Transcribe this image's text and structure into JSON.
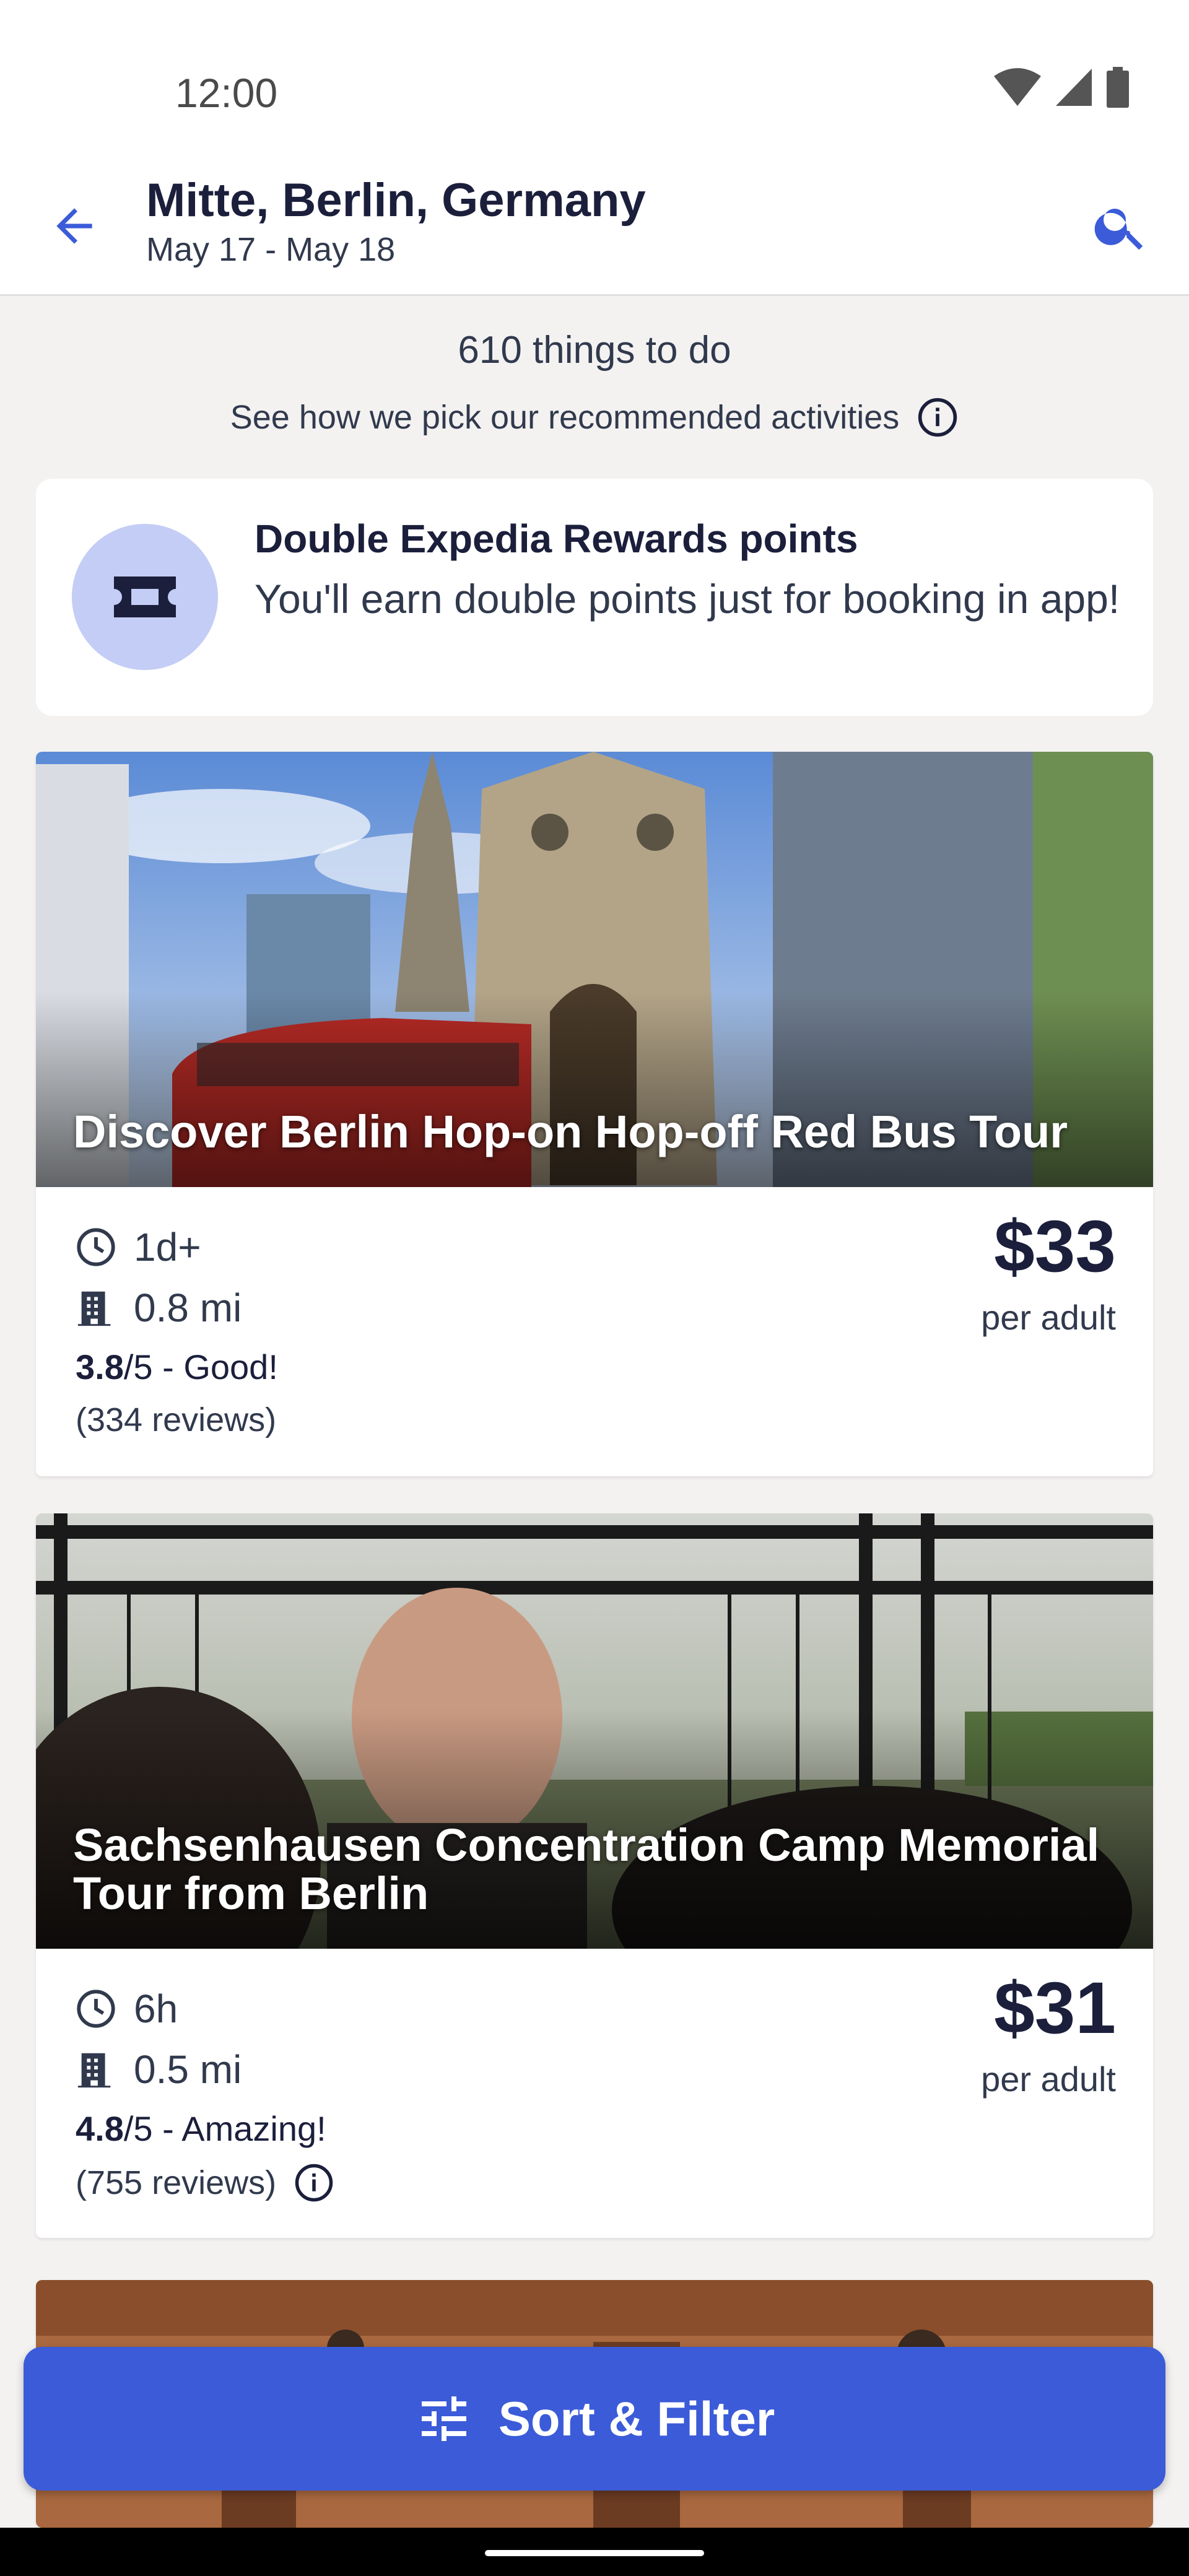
{
  "status_bar": {
    "time": "12:00",
    "icons": [
      "wifi-icon",
      "signal-icon",
      "battery-icon"
    ]
  },
  "header": {
    "title": "Mitte, Berlin, Germany",
    "dates": "May 17 - May 18",
    "back_icon": "arrow-left-icon",
    "search_icon": "search-icon"
  },
  "summary": {
    "count": "610 things to do",
    "recommend_text": "See how we pick our recommended activities",
    "info_icon": "info-icon"
  },
  "rewards": {
    "icon": "ticket-icon",
    "title": "Double Expedia Rewards points",
    "text": "You'll earn double points just for booking in app!"
  },
  "activities": [
    {
      "title": "Discover Berlin Hop-on Hop-off Red Bus Tour",
      "duration": "1d+",
      "distance": "0.8 mi",
      "rating": "3.8",
      "rating_suffix": "/5 - Good!",
      "reviews": "(334 reviews)",
      "price": "$33",
      "price_unit": "per adult"
    },
    {
      "title": "Sachsenhausen Concentration Camp Memorial Tour from Berlin",
      "duration": "6h",
      "distance": "0.5 mi",
      "rating": "4.8",
      "rating_suffix": "/5 - Amazing!",
      "reviews": "(755 reviews)",
      "price": "$31",
      "price_unit": "per adult"
    }
  ],
  "sort_filter": {
    "label": "Sort & Filter",
    "icon": "sliders-icon"
  },
  "colors": {
    "accent": "#3b5bd9",
    "rewards_circle": "#c4cdf5",
    "text_dark": "#1b1f3b"
  }
}
